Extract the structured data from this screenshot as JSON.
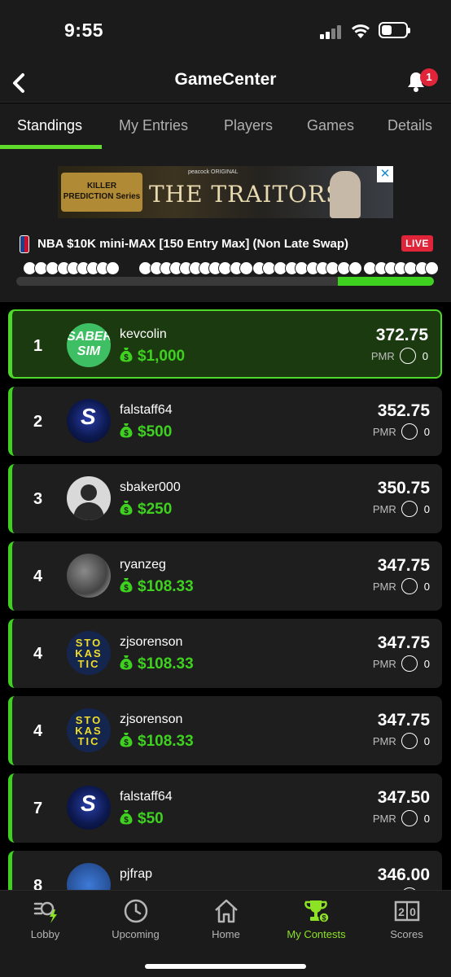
{
  "status_bar": {
    "time": "9:55"
  },
  "header": {
    "title": "GameCenter",
    "notification_count": "1"
  },
  "tabs": [
    {
      "label": "Standings",
      "active": true
    },
    {
      "label": "My Entries",
      "active": false
    },
    {
      "label": "Players",
      "active": false
    },
    {
      "label": "Games",
      "active": false
    },
    {
      "label": "Details",
      "active": false
    }
  ],
  "ad": {
    "left_text": "KILLER PREDICTION Series",
    "small_text": "peacock ORIGINAL",
    "title": "THE TRAITORS"
  },
  "contest": {
    "name": "NBA $10K mini-MAX [150 Entry Max] (Non Late Swap)",
    "status": "LIVE",
    "progress_fraction": 0.23
  },
  "standings": [
    {
      "rank": "1",
      "username": "kevcolin",
      "prize": "$1,000",
      "score": "372.75",
      "pmr_label": "PMR",
      "pmr": "0",
      "avatar": "sabersim",
      "avatar_text": "SABER SIM",
      "highlight": true
    },
    {
      "rank": "2",
      "username": "falstaff64",
      "prize": "$500",
      "score": "352.75",
      "pmr_label": "PMR",
      "pmr": "0",
      "avatar": "stokastic-s",
      "avatar_text": "S",
      "highlight": false
    },
    {
      "rank": "3",
      "username": "sbaker000",
      "prize": "$250",
      "score": "350.75",
      "pmr_label": "PMR",
      "pmr": "0",
      "avatar": "default",
      "avatar_text": "",
      "highlight": false
    },
    {
      "rank": "4",
      "username": "ryanzeg",
      "prize": "$108.33",
      "score": "347.75",
      "pmr_label": "PMR",
      "pmr": "0",
      "avatar": "photo",
      "avatar_text": "",
      "highlight": false
    },
    {
      "rank": "4",
      "username": "zjsorenson",
      "prize": "$108.33",
      "score": "347.75",
      "pmr_label": "PMR",
      "pmr": "0",
      "avatar": "stokastic-grid",
      "avatar_text": "STO KAS TIC",
      "highlight": false
    },
    {
      "rank": "4",
      "username": "zjsorenson",
      "prize": "$108.33",
      "score": "347.75",
      "pmr_label": "PMR",
      "pmr": "0",
      "avatar": "stokastic-grid",
      "avatar_text": "STO KAS TIC",
      "highlight": false
    },
    {
      "rank": "7",
      "username": "falstaff64",
      "prize": "$50",
      "score": "347.50",
      "pmr_label": "PMR",
      "pmr": "0",
      "avatar": "stokastic-s",
      "avatar_text": "S",
      "highlight": false
    },
    {
      "rank": "8",
      "username": "pjfrap",
      "prize": "",
      "score": "346.00",
      "pmr_label": "PMR",
      "pmr": "0",
      "avatar": "blue",
      "avatar_text": "",
      "highlight": false
    }
  ],
  "bottom_nav": [
    {
      "label": "Lobby",
      "icon": "lobby-icon",
      "active": false
    },
    {
      "label": "Upcoming",
      "icon": "clock-icon",
      "active": false
    },
    {
      "label": "Home",
      "icon": "home-icon",
      "active": false
    },
    {
      "label": "My Contests",
      "icon": "trophy-icon",
      "active": true
    },
    {
      "label": "Scores",
      "icon": "scoreboard-icon",
      "active": false
    }
  ],
  "colors": {
    "accent": "#3fd11f",
    "live": "#e0243a",
    "background": "#1b1b1b"
  }
}
